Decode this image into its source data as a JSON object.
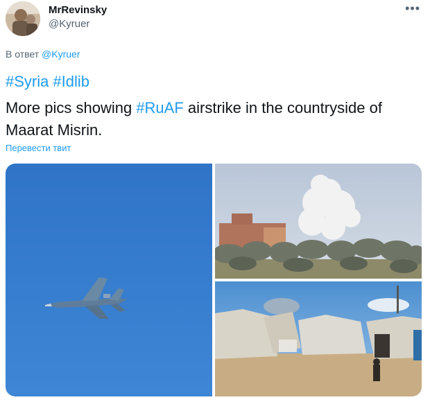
{
  "author": {
    "name": "MrRevinsky",
    "handle": "@Kyruer"
  },
  "reply": {
    "prefix": "В ответ",
    "to": "@Kyruer"
  },
  "tweet": {
    "hashtags": [
      "#Syria",
      "#Idlib"
    ],
    "line1_before": "More pics showing ",
    "hashtag_inline": "#RuAF",
    "line1_after": " airstrike in the countryside of",
    "line2": "Maarat Misrin."
  },
  "translate_label": "Перевести твит",
  "colors": {
    "accent": "#1d9bf0",
    "secondary_text": "#536471"
  },
  "icons": {
    "more": "more-options-icon"
  }
}
